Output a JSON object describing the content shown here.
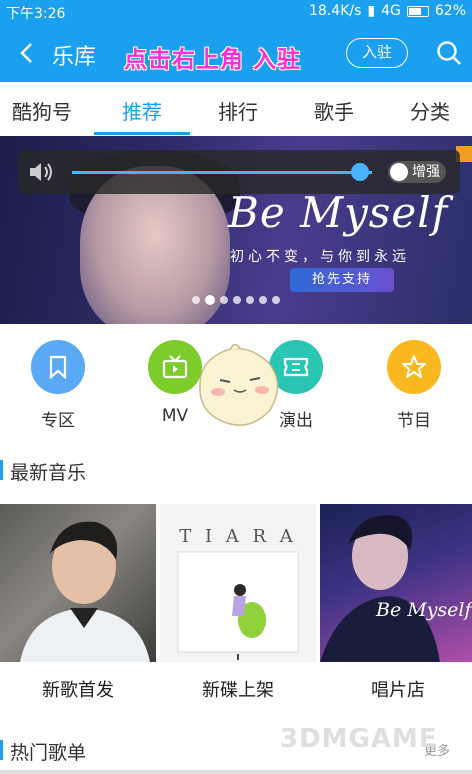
{
  "status_bar": {
    "time": "下午3:26",
    "net_speed": "18.4K/s",
    "network": "4G",
    "battery": "62%"
  },
  "app_bar": {
    "title": "乐库",
    "promo_text": "点击右上角 入驻",
    "join_label": "入驻"
  },
  "tabs": [
    {
      "label": "酷狗号",
      "active": false
    },
    {
      "label": "推荐",
      "active": true
    },
    {
      "label": "排行",
      "active": false
    },
    {
      "label": "歌手",
      "active": false
    },
    {
      "label": "分类",
      "active": false
    }
  ],
  "banner": {
    "title": "Be Myself",
    "subtitle": "初心不变，与你到永远",
    "button_label": "抢先支持",
    "slide_count": 7,
    "active_slide": 1
  },
  "volume_overlay": {
    "level": 0.96,
    "enhance_label": "增强"
  },
  "categories": [
    {
      "label": "专区",
      "icon": "bookmark-icon",
      "color": "#5aa9f5"
    },
    {
      "label": "MV",
      "icon": "tv-icon",
      "color": "#7ccc2c"
    },
    {
      "label": "演出",
      "icon": "ticket-icon",
      "color": "#2bc5b4"
    },
    {
      "label": "节目",
      "icon": "star-icon",
      "color": "#f9b81f"
    }
  ],
  "section_new_music": {
    "title": "最新音乐"
  },
  "album_cards": [
    {
      "label": "新歌首发"
    },
    {
      "label": "新碟上架",
      "cover_text": "T I A R A"
    },
    {
      "label": "唱片店",
      "cover_text": "Be Myself"
    }
  ],
  "section_hot": {
    "title": "热门歌单",
    "more_label": "更多"
  },
  "watermark": "3DMGAME",
  "colors": {
    "brand": "#1ba0f0",
    "promo": "#ff2fd6"
  }
}
